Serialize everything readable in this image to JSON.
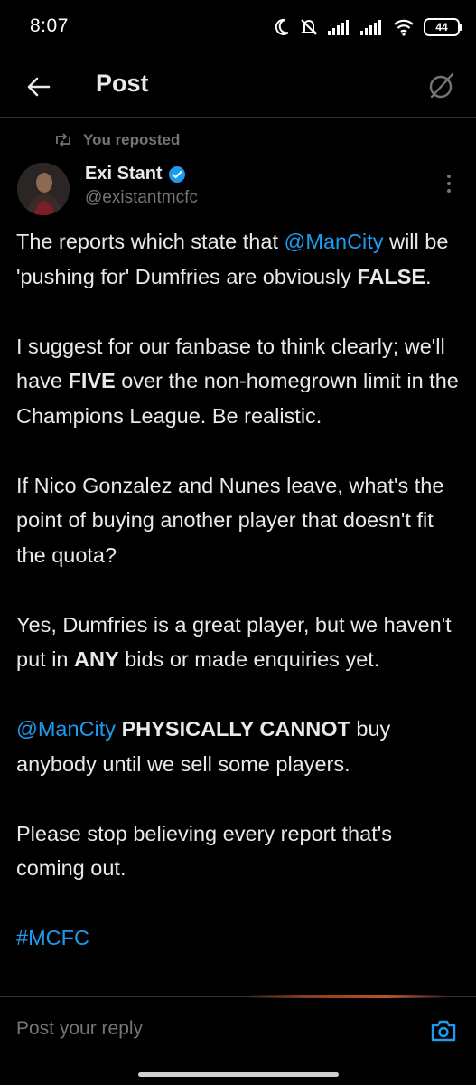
{
  "status_bar": {
    "time": "8:07",
    "battery": "44"
  },
  "header": {
    "title": "Post"
  },
  "repost": {
    "label": "You reposted"
  },
  "author": {
    "name": "Exi Stant",
    "handle": "@existantmcfc"
  },
  "post": {
    "p1_a": "The reports which state that ",
    "p1_mention": "@ManCity",
    "p1_b": " will be 'pushing for' Dumfries are obviously ",
    "p1_bold": "FALSE",
    "p1_c": ".",
    "p2_a": "I suggest for our fanbase to think clearly; we'll have ",
    "p2_bold": "FIVE",
    "p2_b": " over the non-homegrown limit in the Champions League. Be realistic.",
    "p3": "If Nico Gonzalez and Nunes leave, what's the point of buying another player that doesn't fit the quota?",
    "p4_a": "Yes, Dumfries is a great player, but we haven't put in ",
    "p4_bold": "ANY",
    "p4_b": " bids or made enquiries yet.",
    "p5_mention": "@ManCity",
    "p5_bold": " PHYSICALLY CANNOT",
    "p5_b": " buy anybody until we sell some players.",
    "p6": "Please stop believing every report that's coming out.",
    "hashtag": "#MCFC"
  },
  "reply": {
    "placeholder": "Post your reply"
  },
  "colors": {
    "accent": "#1d9bf0",
    "background": "#000000",
    "muted": "#71767b"
  }
}
